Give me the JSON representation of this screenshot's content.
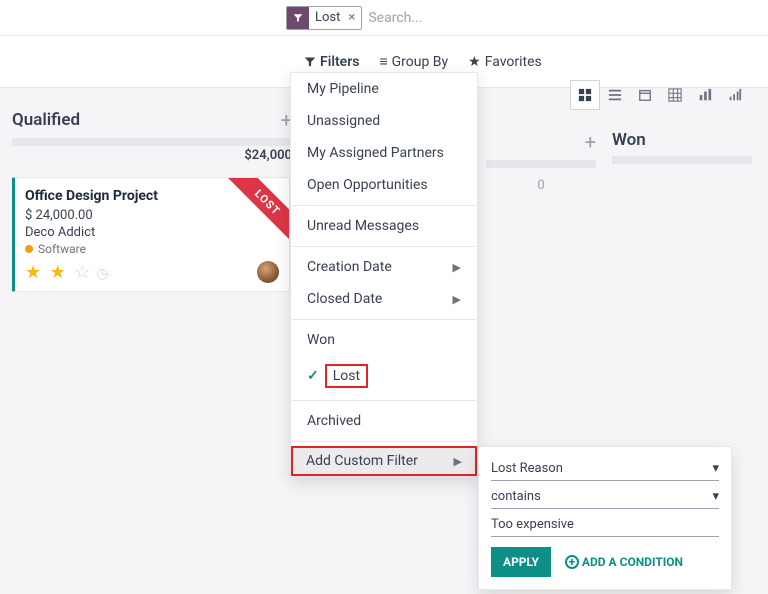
{
  "search": {
    "chip": "Lost",
    "placeholder": "Search..."
  },
  "tabs": {
    "filters": "Filters",
    "groupby": "Group By",
    "favorites": "Favorites"
  },
  "stages": {
    "qualified": {
      "title": "Qualified",
      "amount": "$24,000"
    },
    "proposition_zero": "0",
    "won": {
      "title": "Won"
    }
  },
  "card": {
    "title": "Office Design Project",
    "amount": "$ 24,000.00",
    "customer": "Deco Addict",
    "tag": "Software",
    "ribbon": "LOST"
  },
  "filters_menu": {
    "my_pipeline": "My Pipeline",
    "unassigned": "Unassigned",
    "my_partners": "My Assigned Partners",
    "open_opps": "Open Opportunities",
    "unread": "Unread Messages",
    "creation": "Creation Date",
    "closed": "Closed Date",
    "won": "Won",
    "lost": "Lost",
    "archived": "Archived",
    "add_custom": "Add Custom Filter"
  },
  "custom_filter": {
    "field": "Lost Reason",
    "operator": "contains",
    "value": "Too expensive",
    "apply": "APPLY",
    "add_condition": "ADD A CONDITION"
  }
}
